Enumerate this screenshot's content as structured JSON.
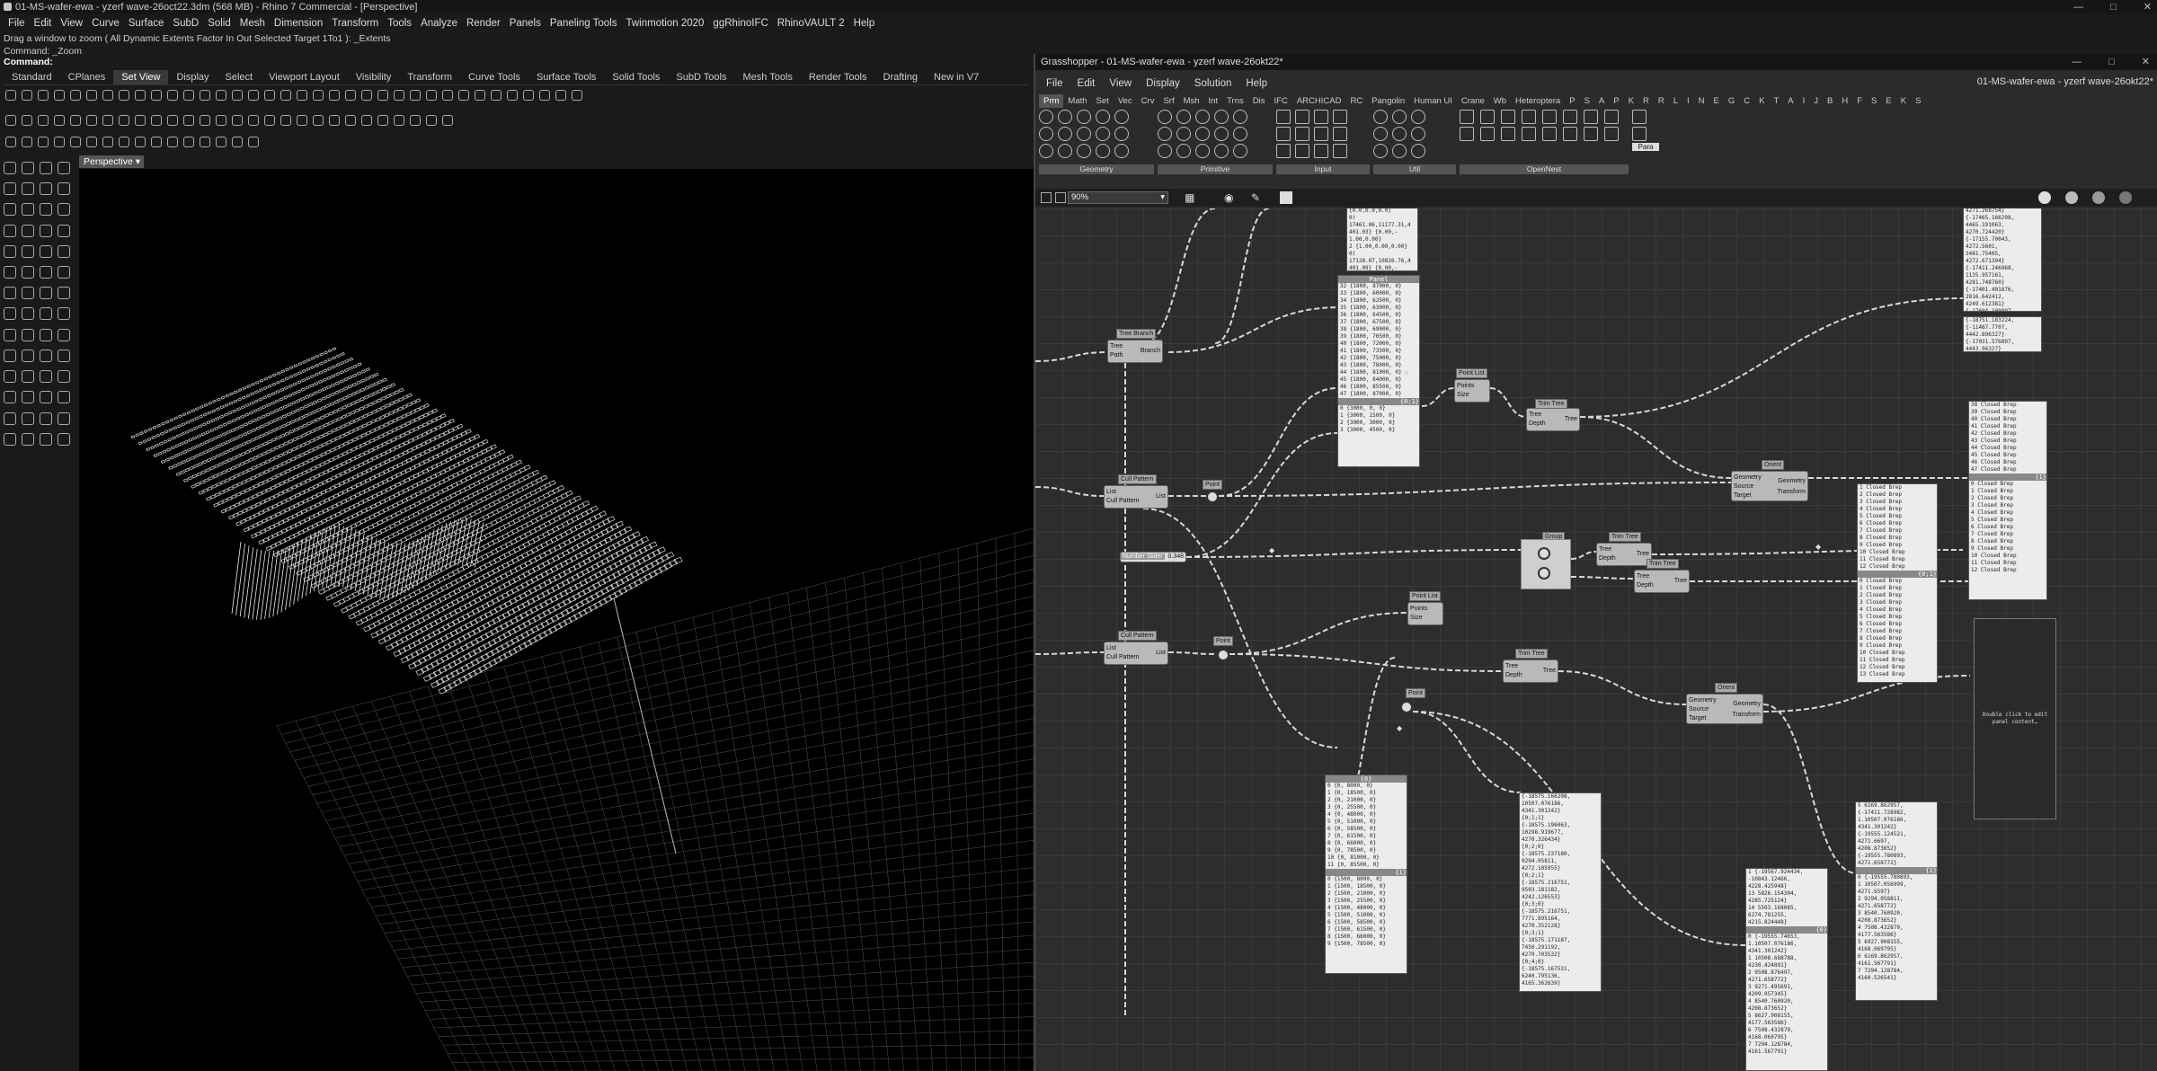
{
  "rhino": {
    "title": "01-MS-wafer-ewa - yzerf wave-26oct22.3dm (568 MB) - Rhino 7 Commercial - [Perspective]",
    "menu": [
      "File",
      "Edit",
      "View",
      "Curve",
      "Surface",
      "SubD",
      "Solid",
      "Mesh",
      "Dimension",
      "Transform",
      "Tools",
      "Analyze",
      "Render",
      "Panels",
      "Paneling Tools",
      "Twinmotion 2020",
      "ggRhinoIFC",
      "RhinoVAULT 2",
      "Help"
    ],
    "command_history": [
      "Drag a window to zoom ( All  Dynamic  Extents  Factor  In  Out  Selected  Target  1To1 ): _Extents",
      "Command: _Zoom"
    ],
    "command_prompt": "Command:",
    "tabs": [
      "Standard",
      "CPlanes",
      "Set View",
      "Display",
      "Select",
      "Viewport Layout",
      "Visibility",
      "Transform",
      "Curve Tools",
      "Surface Tools",
      "Solid Tools",
      "SubD Tools",
      "Mesh Tools",
      "Render Tools",
      "Drafting",
      "New in V7"
    ],
    "active_tab": "Set View",
    "viewport_label": "Perspective"
  },
  "grasshopper": {
    "title": "Grasshopper - 01-MS-wafer-ewa - yzerf wave-26okt22*",
    "document_name": "01-MS-wafer-ewa - yzerf wave-26okt22*",
    "menu": [
      "File",
      "Edit",
      "View",
      "Display",
      "Solution",
      "Help"
    ],
    "tabs": [
      "Prm",
      "Math",
      "Set",
      "Vec",
      "Crv",
      "Srf",
      "Msh",
      "Int",
      "Trns",
      "Dis",
      "IFC",
      "ARCHICAD",
      "RC",
      "Pangolin",
      "Human UI",
      "Crane",
      "Wb",
      "Heteroptera",
      "P",
      "S",
      "A",
      "P",
      "K",
      "R",
      "R",
      "L",
      "I",
      "N",
      "E",
      "G",
      "C",
      "K",
      "T",
      "A",
      "I",
      "J",
      "B",
      "H",
      "F",
      "S",
      "E",
      "K",
      "S"
    ],
    "active_tab": "Prm",
    "ribbon_groups": [
      "Geometry",
      "Primitive",
      "Input",
      "Util",
      "OpenNest"
    ],
    "ribbon_extra": "Para",
    "zoom": "90%",
    "nodes": {
      "tree_branch": {
        "label": "Tree Branch",
        "in": [
          "Tree",
          "Path"
        ],
        "out": "Branch"
      },
      "point_list_1": {
        "label": "Point List",
        "in": [
          "Points",
          "Size"
        ]
      },
      "trim_tree_1": {
        "label": "Trim Tree",
        "in": [
          "Tree",
          "Depth"
        ],
        "out": "Tree"
      },
      "cull_pattern_1": {
        "label": "Cull Pattern",
        "in": [
          "List",
          "Cull Pattern"
        ],
        "out": "List"
      },
      "point_1": "Point",
      "number_slider": {
        "label": "Number Slider",
        "value": "0.348"
      },
      "orient_1": {
        "label": "Orient",
        "in": [
          "Geometry",
          "Source",
          "Target"
        ],
        "out": [
          "Geometry",
          "Transform"
        ]
      },
      "trim_tree_2": {
        "label": "Trim Tree",
        "in": [
          "Tree",
          "Depth"
        ],
        "out": "Tree"
      },
      "trim_tree_3": {
        "label": "Trim Tree",
        "in": [
          "Tree",
          "Depth"
        ],
        "out": "Tree"
      },
      "point_list_2": {
        "label": "Point List",
        "in": [
          "Points",
          "Size"
        ]
      },
      "cull_pattern_2": {
        "label": "Cull Pattern",
        "in": [
          "List",
          "Cull Pattern"
        ],
        "out": "List"
      },
      "point_2": "Point",
      "trim_tree_4": {
        "label": "Trim Tree",
        "in": [
          "Tree",
          "Depth"
        ],
        "out": "Tree"
      },
      "point_3": "Point",
      "orient_2": {
        "label": "Orient",
        "in": [
          "Geometry",
          "Source",
          "Target"
        ],
        "out": [
          "Geometry",
          "Transform"
        ]
      },
      "group_label": "Group"
    },
    "panels": {
      "top_small": {
        "rows": [
          "{0.0,0.0,0.0}",
          "0)",
          "17461.06,11177.31,4",
          "401.03} {0.00,-",
          "1.00,0.00}",
          "2 {1.00,0.00,0.00}",
          "0)",
          "17128.07,10826.76,4",
          "401.09} {0.00,-",
          "1.00,0.00,0.00}",
          "0)"
        ]
      },
      "panel_main": {
        "title": "Panel",
        "rows": [
          "32 {1800, 87000, 0}",
          "33 {1800, 60000, 0}",
          "34 {1800, 62500, 0}",
          "35 {1800, 63000, 0}",
          "36 {1800, 64500, 0}",
          "37 {1800, 67500, 0}",
          "38 {1800, 69000, 0}",
          "39 {1800, 70500, 0}",
          "40 {1800, 72000, 0}",
          "41 {1800, 73500, 0}",
          "42 {1800, 75000, 0}",
          "43 {1800, 78000, 0}",
          "44 {1800, 81000, 0}",
          "45 {1800, 84000, 0}",
          "46 {1800, 85500, 0}",
          "47 {1800, 87000, 0}"
        ],
        "sub": "{0;1}",
        "rows2": [
          "0 {3000, 0, 0}",
          "1 {3000, 1500, 0}",
          "2 {3000, 3000, 0}",
          "3 {3000, 4500, 0}"
        ]
      },
      "panel_right_top": {
        "rows": [
          "3256.358394,",
          "4271.268754}",
          "{-17465.166298,",
          "4465.191063,",
          "4270.724420}",
          "{-17155.70043,",
          "4272.5601,",
          "3481.75405,",
          "4272.671394}",
          "{-17411.246968,",
          "1135.957161,",
          "4281.748760}",
          "{-17401.401876,",
          "2816.642412,",
          "4249.612381}",
          "{-17604.109897,",
          "1484.308590,",
          "6167.252658,",
          "4242.555030}",
          "{-17411.728982,",
          "2618.967462,",
          "4247.195940}"
        ],
        "footer": "{0}"
      },
      "panel_right_top_b": {
        "rows": [
          "{-18751.183224,",
          "{-11487.7707,",
          "4442.896327}",
          "{-17031.576897,",
          "4443.96327}"
        ]
      },
      "closed_brep_right": {
        "rows": [
          "38 Closed Brep",
          "39 Closed Brep",
          "40 Closed Brep",
          "41 Closed Brep",
          "42 Closed Brep",
          "43 Closed Brep",
          "44 Closed Brep",
          "45 Closed Brep",
          "46 Closed Brep",
          "47 Closed Brep"
        ],
        "sub": "{1}",
        "rows2": [
          "0 Closed Brep",
          "1 Closed Brep",
          "2 Closed Brep",
          "3 Closed Brep",
          "4 Closed Brep",
          "5 Closed Brep",
          "6 Closed Brep",
          "7 Closed Brep",
          "8 Closed Brep",
          "9 Closed Brep",
          "10 Closed Brep",
          "11 Closed Brep",
          "12 Closed Brep"
        ]
      },
      "closed_brep_mid": {
        "rows": [
          "1 Closed Brep",
          "2 Closed Brep",
          "3 Closed Brep",
          "4 Closed Brep",
          "5 Closed Brep",
          "6 Closed Brep",
          "7 Closed Brep",
          "8 Closed Brep",
          "9 Closed Brep",
          "10 Closed Brep",
          "11 Closed Brep",
          "12 Closed Brep"
        ],
        "sub": "{0;1}",
        "rows2": [
          "0 Closed Brep",
          "1 Closed Brep",
          "2 Closed Brep",
          "3 Closed Brep",
          "4 Closed Brep",
          "5 Closed Brep",
          "6 Closed Brep",
          "7 Closed Brep",
          "8 Closed Brep",
          "9 Closed Brep",
          "10 Closed Brep",
          "11 Closed Brep",
          "12 Closed Brep",
          "13 Closed Brep"
        ]
      },
      "empty_panel": {
        "text": "Double click to edit panel content…"
      },
      "bottom_a": {
        "title": "{0}",
        "rows": [
          "0 {0, 8000, 0}",
          "1 {0, 18500, 0}",
          "2 {0, 21000, 0}",
          "3 {0, 25500, 0}",
          "4 {0, 48000, 0}",
          "5 {0, 51000, 0}",
          "6 {0, 58500, 0}",
          "7 {0, 61500, 0}",
          "8 {0, 66000, 0}",
          "9 {0, 78500, 0}",
          "10 {0, 81000, 0}",
          "11 {0, 85500, 0}"
        ],
        "sub": "{1}",
        "rows2": [
          "0 {1500, 8000, 0}",
          "1 {1500, 18500, 0}",
          "2 {1500, 21000, 0}",
          "3 {1500, 25500, 0}",
          "4 {1500, 48000, 0}",
          "5 {1500, 51000, 0}",
          "6 {1500, 58500, 0}",
          "7 {1500, 61500, 0}",
          "8 {1500, 66000, 0}",
          "9 {1500, 78500, 0}"
        ]
      },
      "bottom_b": {
        "rows": [
          "{-18575.166298,",
          "10507.076186,",
          "4341.301242}",
          "{0;1;1}",
          "{-18575.196063,",
          "10298.919677,",
          "4270.326434}",
          "{0;2;0}",
          "{-18575.237180,",
          "9294.05811,",
          "4272.105955}",
          "{0;2;1}",
          "{-18575.216751,",
          "9503.181182,",
          "4242.126553}",
          "{0;3;0}",
          "{-18575.216751,",
          "7771.895164,",
          "4270.352128}",
          "{0;3;1}",
          "{-18575.171187,",
          "7450.291192,",
          "4270.703532}",
          "{0;4;0}",
          "{-18575.167531,",
          "6240.795136,",
          "4165.362639}"
        ]
      },
      "bottom_c": {
        "rows": [
          "1 {-19567.924434,",
          "-10843.12466,",
          "4228.425948}",
          "13 5826.154304,",
          "4285.725124}",
          "14 5503.168085,",
          "6274.781255,",
          "4215.824448}"
        ],
        "sub": "{0}",
        "rows2": [
          "0 {-19555.74653,",
          "1.10507.076186,",
          "4341.301242}",
          "1 10508.688788,",
          "4230.424891}",
          "2 9508.876497,",
          "4271.658772}",
          "3 9271.495691,",
          "4209.057345}",
          "4 8540.760920,",
          "4208.873652}",
          "5 8627.908155,",
          "4177.563586}",
          "6 7508.432879,",
          "4168.069795}",
          "7 7294.128784,",
          "4161.567791}"
        ]
      },
      "bottom_d": {
        "rows": [
          "5 6169.862957,",
          "{-17411.728982,",
          "1.10507.076186,",
          "4341.301242}",
          "{-19555.124521,",
          "4271.6697,",
          "4208.873652}",
          "{-19555.780893,",
          "4271.658772}"
        ],
        "sub": "{1}",
        "rows2": [
          "0 {-19555.780893,",
          "1 10507.056999,",
          "4271.6597}",
          "2 9294.058811,",
          "4271.658772}",
          "3 8540.760920,",
          "4208.873652}",
          "4 7508.432879,",
          "4177.563586}",
          "5 6927.908155,",
          "4168.069795}",
          "6 6169.862957,",
          "4161.567791}",
          "7 7294.128784,",
          "4160.526541}"
        ]
      }
    }
  }
}
